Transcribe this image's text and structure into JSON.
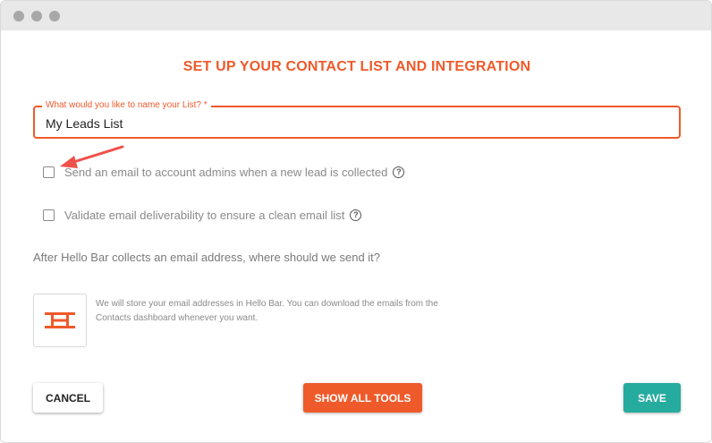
{
  "colors": {
    "accent": "#ef5a2a",
    "save": "#26ab9f",
    "muted_text": "#8a8a8a",
    "arrow": "#f0504a"
  },
  "window": {
    "controls": [
      "close",
      "minimize",
      "maximize"
    ]
  },
  "page": {
    "title": "SET UP YOUR CONTACT LIST AND INTEGRATION"
  },
  "list_name": {
    "label": "What would you like to name your List? *",
    "value": "My Leads List"
  },
  "options": {
    "notify_admins": {
      "label": "Send an email to account admins when a new lead is collected",
      "checked": false,
      "help_icon": "question-circle-icon"
    },
    "validate_email": {
      "label": "Validate email deliverability to ensure a clean email list",
      "checked": false,
      "help_icon": "question-circle-icon"
    }
  },
  "integration": {
    "question": "After Hello Bar collects an email address, where should we send it?",
    "logo_icon": "hello-bar-logo-icon",
    "description": "We will store your email addresses in Hello Bar. You can download the emails from the Contacts dashboard whenever you want."
  },
  "buttons": {
    "cancel": "CANCEL",
    "show_all_tools": "SHOW ALL TOOLS",
    "save": "SAVE"
  }
}
